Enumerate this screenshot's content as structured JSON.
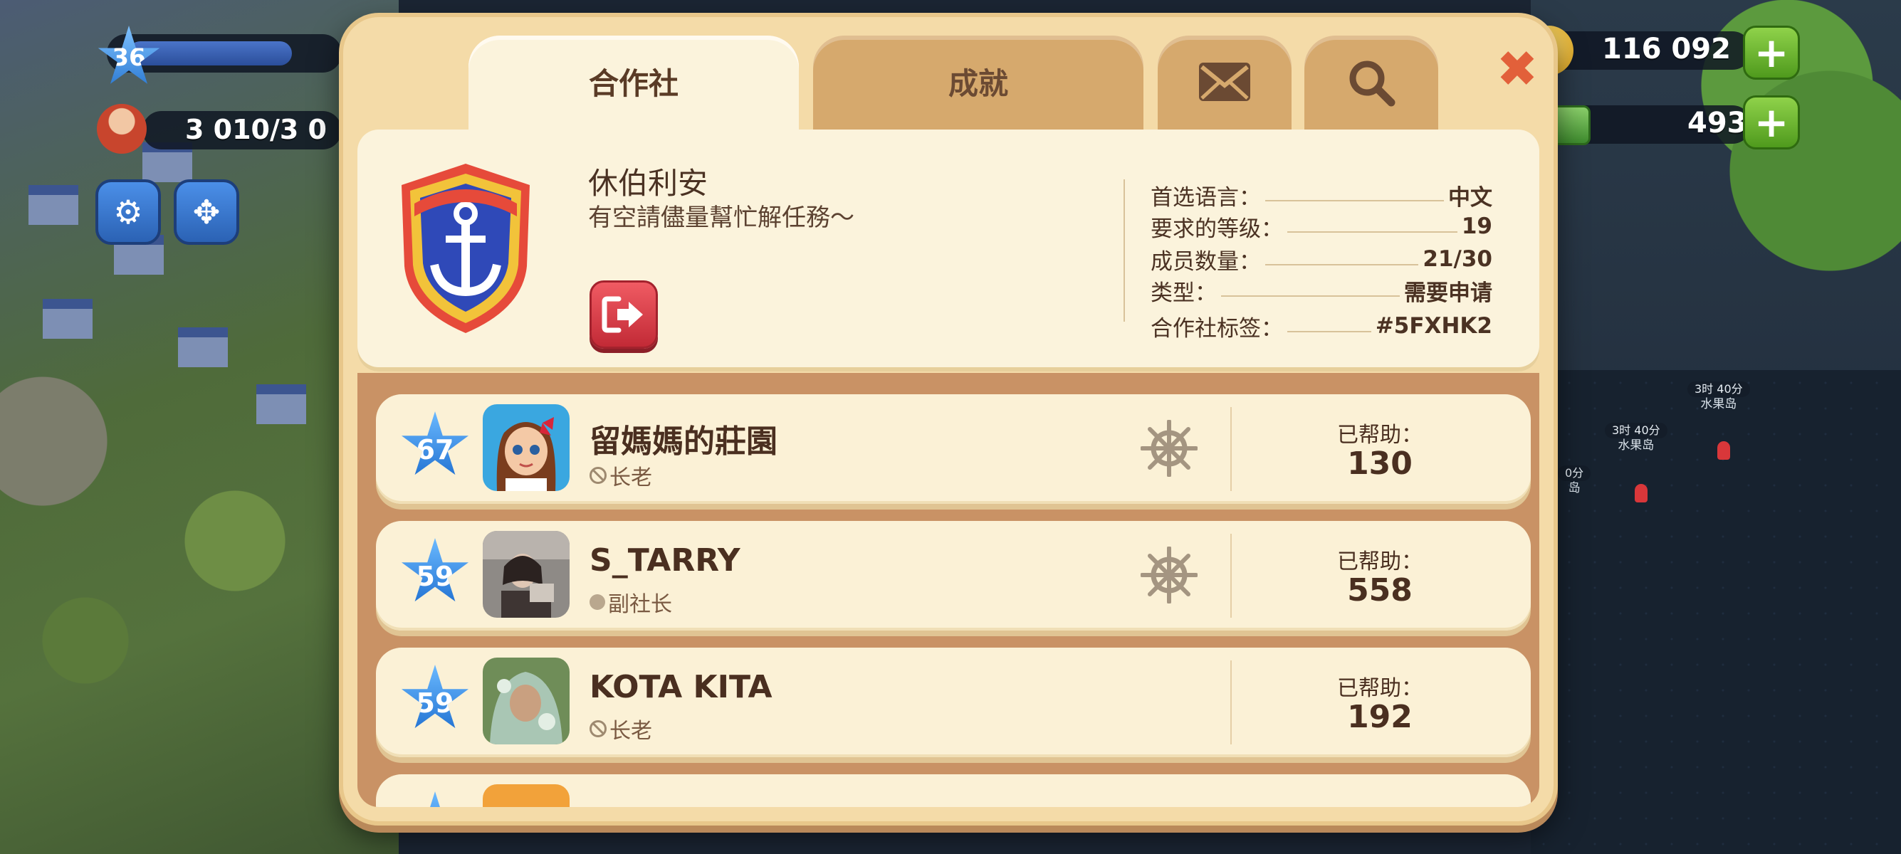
{
  "hud": {
    "player_level": "36",
    "population": "3 010/3 0",
    "coins": "116 092",
    "cash": "493",
    "plus_label": "+",
    "settings_icon": "gear-icon",
    "move_icon": "move-arrows-icon"
  },
  "map_labels": [
    {
      "timer": "3时 40分",
      "name": "水果岛"
    },
    {
      "timer": "3时 40分",
      "name": "水果岛"
    },
    {
      "timer": "0分",
      "name": "岛"
    }
  ],
  "tabs": [
    {
      "label": "合作社",
      "active": true
    },
    {
      "label": "成就",
      "active": false
    },
    {
      "label": "",
      "icon": "mail-icon"
    },
    {
      "label": "",
      "icon": "search-icon"
    }
  ],
  "close_label": "✖",
  "club": {
    "name": "休伯利安",
    "description": "有空請儘量幫忙解任務～",
    "badge_icon": "anchor-shield-icon",
    "leave_icon": "exit-door-icon",
    "stats": [
      {
        "label": "首选语言：",
        "value": "中文"
      },
      {
        "label": "要求的等级：",
        "value": "19"
      },
      {
        "label": "成员数量：",
        "value": "21/30"
      },
      {
        "label": "类型：",
        "value": "需要申请"
      },
      {
        "label": "合作社标签：",
        "value": "#5FXHK2"
      }
    ]
  },
  "members": [
    {
      "level": "67",
      "name": "留媽媽的莊園",
      "role": "长老",
      "role_icon": "ban-icon",
      "helm": true,
      "helped_label": "已帮助：",
      "helped": "130"
    },
    {
      "level": "59",
      "name": "S_TARRY",
      "role": "副社长",
      "role_icon": "dot-icon",
      "helm": true,
      "helped_label": "已帮助：",
      "helped": "558"
    },
    {
      "level": "59",
      "name": "KOTA KITA",
      "role": "长老",
      "role_icon": "ban-icon",
      "helm": false,
      "helped_label": "已帮助：",
      "helped": "192"
    }
  ],
  "colors": {
    "panel": "#f4dba8",
    "card": "#fbf3dc",
    "text_brown": "#4a2f20",
    "close_orange": "#e2603a",
    "level_blue": "#1f6fd0"
  }
}
